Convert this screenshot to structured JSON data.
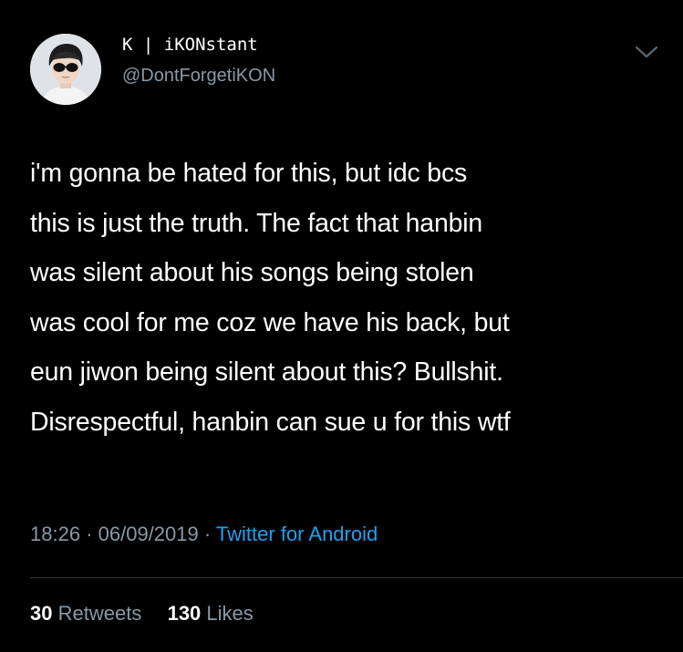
{
  "user": {
    "display_name": "K | iKONstant",
    "handle": "@DontForgetiKON",
    "avatar_icon": "user-avatar-sunglasses"
  },
  "menu": {
    "icon": "chevron-down-icon"
  },
  "tweet": {
    "lines": [
      "i'm gonna be hated for this, but idc bcs",
      "this is just the truth. The fact that hanbin",
      "was silent about his songs being stolen",
      "was cool for me coz we have his back, but",
      "eun jiwon being silent about this? Bullshit.",
      "Disrespectful, hanbin can sue u for this wtf"
    ]
  },
  "meta": {
    "time": "18:26",
    "separator": "·",
    "date": "06/09/2019",
    "source": "Twitter for Android"
  },
  "stats": {
    "retweets_count": "30",
    "retweets_label": "Retweets",
    "likes_count": "130",
    "likes_label": "Likes"
  },
  "colors": {
    "background": "#000000",
    "text": "#ffffff",
    "secondary": "#8899a6",
    "accent": "#1da1f2",
    "divider": "#2f3336"
  }
}
